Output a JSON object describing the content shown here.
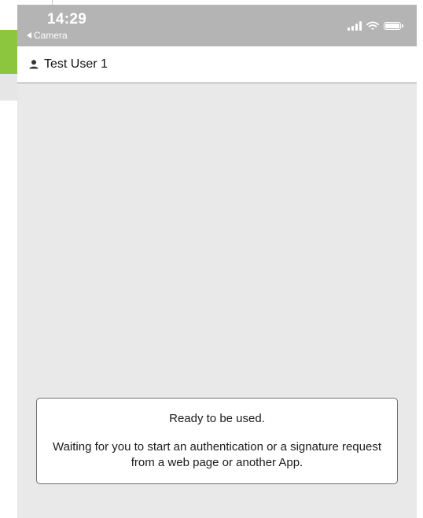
{
  "status_bar": {
    "time": "14:29",
    "back_label": "Camera",
    "icons": [
      "signal-icon",
      "wifi-icon",
      "battery-icon"
    ]
  },
  "user_bar": {
    "icon": "user-icon",
    "name": "Test User 1"
  },
  "status_card": {
    "title": "Ready to be used.",
    "message": "Waiting for you to start an authentication or a signature request from a web page or another App."
  },
  "colors": {
    "status_bar_bg": "#b4b4b4",
    "body_bg": "#e9e9e9",
    "accent_green": "#8cc63f"
  }
}
